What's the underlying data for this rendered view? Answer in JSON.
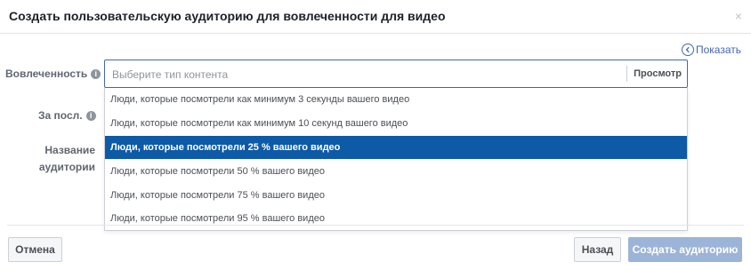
{
  "dialog": {
    "title": "Создать пользовательскую аудиторию для вовлеченности для видео",
    "close_icon": "×",
    "show_link": "Показать"
  },
  "form": {
    "engagement_label": "Вовлеченность",
    "period_label": "За посл.",
    "name_label_line1": "Название",
    "name_label_line2": "аудитории",
    "content_type_placeholder": "Выберите тип контента",
    "preview_label": "Просмотр"
  },
  "dropdown": {
    "selected_index": 2,
    "options": [
      "Люди, которые посмотрели как минимум 3 секунды вашего видео",
      "Люди, которые посмотрели как минимум 10 секунд вашего видео",
      "Люди, которые посмотрели 25 % вашего видео",
      "Люди, которые посмотрели 50 % вашего видео",
      "Люди, которые посмотрели 75 % вашего видео",
      "Люди, которые посмотрели 95 % вашего видео"
    ]
  },
  "footer": {
    "cancel_label": "Отмена",
    "back_label": "Назад",
    "create_label": "Создать аудиторию"
  },
  "colors": {
    "accent": "#4267b2",
    "selected_option_bg": "#0d5aa7",
    "disabled_primary_bg": "#9cb4d8"
  },
  "icons": {
    "info": "info-icon",
    "close": "close-icon",
    "chevron": "chevron-left-circle-icon"
  }
}
